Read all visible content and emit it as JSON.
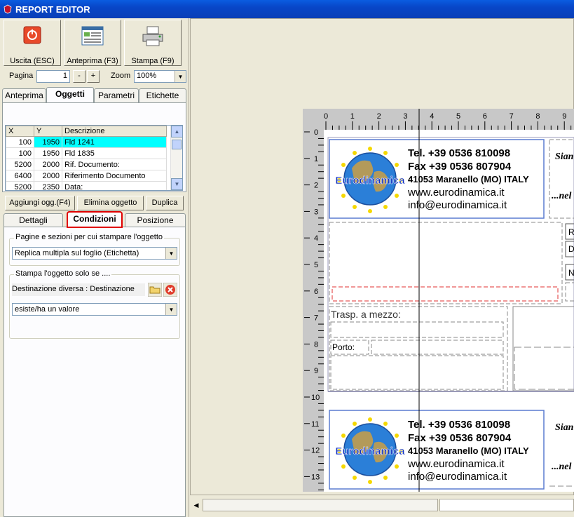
{
  "window": {
    "title": "REPORT EDITOR"
  },
  "toolbar": {
    "exit_label": "Uscita (ESC)",
    "preview_label": "Anteprima (F3)",
    "print_label": "Stampa (F9)"
  },
  "pager": {
    "page_label": "Pagina",
    "page_value": "1",
    "minus": "-",
    "plus": "+",
    "zoom_label": "Zoom",
    "zoom_value": "100%"
  },
  "tabs": {
    "items": [
      "Anteprima",
      "Oggetti",
      "Parametri",
      "Etichette"
    ],
    "active": "Oggetti"
  },
  "objects_table": {
    "columns": [
      "X",
      "Y",
      "Descrizione"
    ],
    "rows": [
      {
        "x": "100",
        "y": "1950",
        "desc": "Fld 1241"
      },
      {
        "x": "100",
        "y": "1950",
        "desc": "Fld 1835"
      },
      {
        "x": "5200",
        "y": "2000",
        "desc": "Rif. Documento:"
      },
      {
        "x": "6400",
        "y": "2000",
        "desc": "Riferimento Documento"
      },
      {
        "x": "5200",
        "y": "2350",
        "desc": "Data:"
      }
    ]
  },
  "actions": {
    "add": "Aggiungi ogg.(F4)",
    "delete": "Elimina oggetto",
    "duplicate": "Duplica"
  },
  "subtabs": {
    "items": [
      "Dettagli",
      "Condizioni",
      "Posizione"
    ],
    "active": "Condizioni"
  },
  "conditions": {
    "group1_caption": "Pagine e sezioni per cui stampare l'oggetto",
    "group1_value": "Replica multipla sul foglio (Etichetta)",
    "group2_caption": "Stampa l'oggetto solo se ....",
    "dest_value": "Destinazione diversa : Destinazione",
    "cond_value": "esiste/ha un valore"
  },
  "ruler": {
    "h_ticks": [
      "0",
      "1",
      "2",
      "3",
      "4",
      "5",
      "6",
      "7",
      "8",
      "9"
    ],
    "v_ticks": [
      "0",
      "1",
      "2",
      "3",
      "4",
      "5",
      "6",
      "7",
      "8",
      "9",
      "10",
      "11",
      "12",
      "13"
    ]
  },
  "label": {
    "logo_text": "Eurodinamica",
    "tel": "Tel. +39 0536 810098",
    "fax": "Fax +39 0536 807904",
    "address": "41053 Maranello (MO) ITALY",
    "web": "www.eurodinamica.it",
    "email": "info@eurodinamica.it",
    "right_top": "Sian",
    "right_bottom": "...nel",
    "trasp": "Trasp. a mezzo:",
    "porto": "Porto:",
    "box_r": "R",
    "box_d": "D",
    "box_n": "N"
  },
  "colors": {
    "selection": "#00ffff",
    "accent": "#0a5ce0",
    "highlight_border": "#e00000"
  }
}
